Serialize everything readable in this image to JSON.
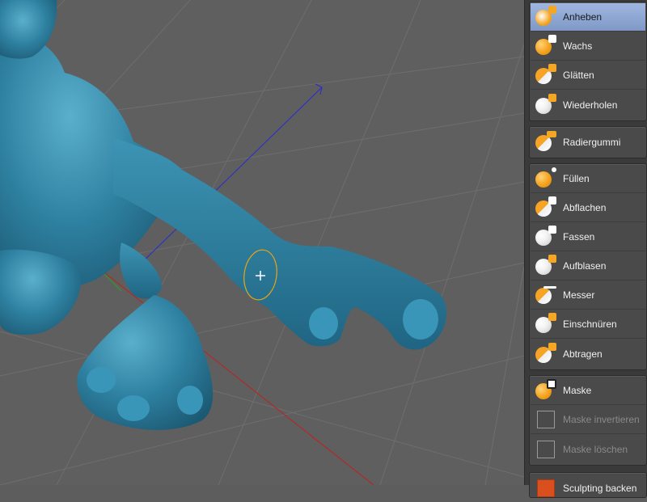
{
  "toolbar": {
    "groups": [
      {
        "items": [
          {
            "label": "Anheben",
            "icon": "lift-icon",
            "active": true
          },
          {
            "label": "Wachs",
            "icon": "wax-icon"
          },
          {
            "label": "Glätten",
            "icon": "smooth-icon"
          },
          {
            "label": "Wiederholen",
            "icon": "repeat-icon"
          }
        ]
      },
      {
        "items": [
          {
            "label": "Radiergummi",
            "icon": "eraser-icon"
          }
        ]
      },
      {
        "items": [
          {
            "label": "Füllen",
            "icon": "fill-icon"
          },
          {
            "label": "Abflachen",
            "icon": "flatten-icon"
          },
          {
            "label": "Fassen",
            "icon": "grab-icon"
          },
          {
            "label": "Aufblasen",
            "icon": "inflate-icon"
          },
          {
            "label": "Messer",
            "icon": "knife-icon"
          },
          {
            "label": "Einschnüren",
            "icon": "pinch-icon"
          },
          {
            "label": "Abtragen",
            "icon": "scrape-icon"
          }
        ]
      },
      {
        "items": [
          {
            "label": "Maske",
            "icon": "mask-icon"
          },
          {
            "label": "Maske invertieren",
            "icon": "mask-invert-icon",
            "disabled": true
          },
          {
            "label": "Maske löschen",
            "icon": "mask-clear-icon",
            "disabled": true
          }
        ]
      },
      {
        "items": [
          {
            "label": "Sculpting backen",
            "icon": "bake-icon"
          }
        ]
      }
    ]
  },
  "colors": {
    "model": "#2f7f9c",
    "active_tool": "#8ea8d6",
    "brush_cursor": "#e6a317",
    "viewport_bg": "#5f5f5f"
  }
}
